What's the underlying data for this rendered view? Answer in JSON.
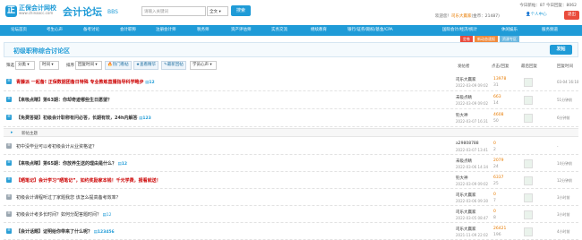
{
  "header": {
    "logo_mark": "正",
    "logo_text": "正保会计网校",
    "logo_sub": "www.chinaacc.com",
    "forum_title": "会计论坛",
    "forum_bbs": "BBS",
    "search_placeholder": "请输入关键词",
    "search_scope": "全文",
    "search_button": "搜索",
    "stats": "今日新帖：87   今日回复：8062",
    "user_greeting": "欢迎您！",
    "user_name": "司乐大赢家",
    "user_coins": "(金币：21487)",
    "user_center": "个人中心",
    "logout": "退出"
  },
  "nav": {
    "items": [
      "论坛首页",
      "考生心声",
      "备考讨论",
      "会计职称",
      "注册会计师",
      "税务师",
      "资产评估师",
      "实务交流",
      "继续教育",
      "银行/证券/期权/基金/CPA",
      "国际会计/经济/统计",
      "休闲娱乐",
      "服务频道"
    ]
  },
  "subtabs": [
    "定卷",
    "新动态速报",
    "资源专区"
  ],
  "forum": {
    "name": "初级职称综合讨论区",
    "post_button": "发帖"
  },
  "toolbar": {
    "filter_label": "筛选",
    "category": "分类",
    "time": "时间",
    "sort_label": "排序",
    "sort_value": "回复时间",
    "btn_sticky": "热门看帖",
    "btn_essence": "查看精华",
    "btn_new": "最新回帖",
    "btn_dropdown": "学员心声",
    "col_author": "发帖者",
    "col_replies": "点击/回复",
    "col_last": "最后回复",
    "col_time": "回复时间"
  },
  "pinned": [
    {
      "title": "青藤派 一起备! 正保数据团备日特殊 专业教练直播指导科学略步",
      "pages": "12",
      "author": "司乐大赢家",
      "date": "2022-03-09 09:02",
      "replies": "13978",
      "views": "31",
      "last": "03-04 16:10",
      "color": "#cc0000",
      "bold": true
    },
    {
      "title": "【来吸点睛】第63期：你却奇迹哪些生日愿望？",
      "pages": "",
      "author": "未吸点睛",
      "date": "2022-03-09 09:02",
      "replies": "663",
      "views": "14",
      "last": "51分钟前",
      "color": "#333",
      "bold": true
    },
    {
      "title": "【免费答疑】初级会计职称有问必答，长期有效，24h内解答",
      "pages": "123",
      "author": "钓大神",
      "date": "2022-03-07 16:31",
      "replies": "4608",
      "views": "50",
      "last": "6分钟前",
      "color": "#333",
      "bold": true
    }
  ],
  "divider": "新帖主题",
  "normal": [
    {
      "title": "初中没毕业可以考初级会计从业资格证？",
      "pages": "",
      "author": "a29808788",
      "date": "2022-03-07 13:41",
      "replies": "0",
      "views": "2",
      "last": "-",
      "color": "#333",
      "bold": false
    },
    {
      "title": "【来吸点睛】第65期：你放养生送的理由是什么？",
      "pages": "12",
      "author": "未吸点睛",
      "date": "2022-03-06 14:34",
      "replies": "2079",
      "views": "24",
      "last": "14分钟前",
      "color": "#333",
      "bold": true
    },
    {
      "title": "【晒笔记】会计学习“晒笔记”，如约奖励家本钱！千元学费，报看就送！",
      "pages": "",
      "author": "钓大神",
      "date": "2022-03-09 09:02",
      "replies": "6337",
      "views": "25",
      "last": "12分钟前",
      "color": "#cc0000",
      "bold": true
    },
    {
      "title": "初级会计课程听过了家题我您 该怎么提高备考效率？",
      "pages": "",
      "author": "司乐大赢家",
      "date": "2022-03-06 09:30",
      "replies": "0",
      "views": "7",
      "last": "3小时前",
      "color": "#333",
      "bold": false
    },
    {
      "title": "初级会计考多长时间？如何分配答题时间？",
      "pages": "12",
      "author": "司乐大赢家",
      "date": "2022-03-05 08:47",
      "replies": "0",
      "views": "8",
      "last": "3小时前",
      "color": "#333",
      "bold": false
    },
    {
      "title": "【会计话题】证明给你带来了什么呢？",
      "pages": "123456",
      "author": "司乐大赢家",
      "date": "2021-11-09 22:02",
      "replies": "26421",
      "views": "196",
      "last": "4小时前",
      "color": "#333",
      "bold": true
    }
  ],
  "colors": {
    "accent": "#1f9bd7",
    "orange": "#e87b00",
    "red": "#cc0000"
  }
}
